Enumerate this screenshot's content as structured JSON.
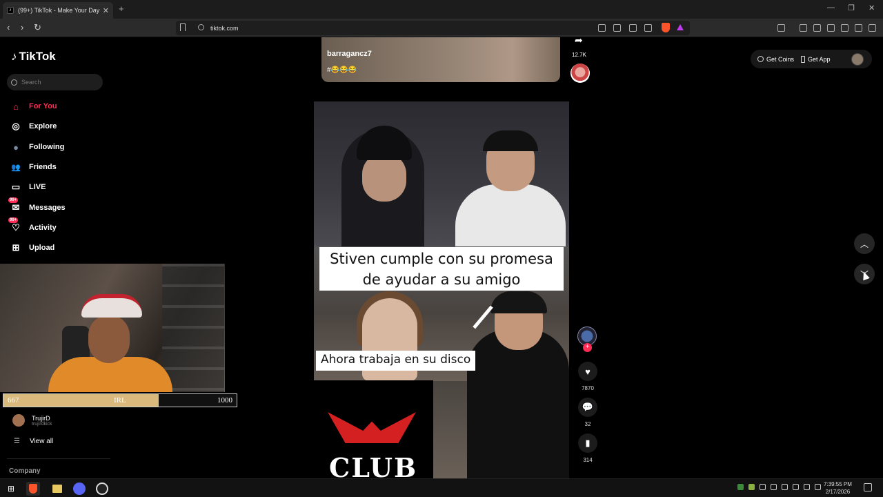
{
  "browser": {
    "tab_title": "(99+) TikTok - Make Your Day",
    "tab_favicon": "tiktok-icon",
    "new_tab": "+",
    "url": "tiktok.com",
    "window_controls": [
      "—",
      "❐",
      "✕"
    ]
  },
  "sidebar": {
    "logo": "TikTok",
    "search_placeholder": "Search",
    "items": [
      {
        "label": "For You",
        "icon": "home-icon",
        "glyph": "⌂",
        "active": true
      },
      {
        "label": "Explore",
        "icon": "compass-icon",
        "glyph": "◎"
      },
      {
        "label": "Following",
        "icon": "following-avatar-icon",
        "glyph": "●"
      },
      {
        "label": "Friends",
        "icon": "friends-icon",
        "glyph": "👥"
      },
      {
        "label": "LIVE",
        "icon": "live-tv-icon",
        "glyph": "▭"
      },
      {
        "label": "Messages",
        "icon": "messages-icon",
        "glyph": "✉",
        "badge": "99+"
      },
      {
        "label": "Activity",
        "icon": "activity-icon",
        "glyph": "♡",
        "badge": "99+"
      },
      {
        "label": "Upload",
        "icon": "upload-icon",
        "glyph": "⊞"
      }
    ],
    "following_account": {
      "name": "TrujirD",
      "handle": "trujirdkick"
    },
    "view_all": "View all",
    "company": "Company"
  },
  "stream_overlay": {
    "goal_current": "667",
    "goal_label": "IRL",
    "goal_max": "1000",
    "goal_fraction": 0.667
  },
  "previous_video": {
    "username": "barragancz7",
    "caption": "#😂😂😂",
    "share_count": "12.7K"
  },
  "video": {
    "caption_line1": "Stiven cumple con su promesa",
    "caption_line2": "de ayudar a su amigo",
    "caption_bottom": "Ahora trabaja en su disco",
    "logo_text": "CLUB",
    "likes": "7870",
    "comments": "32",
    "saves": "314"
  },
  "header": {
    "get_coins": "Get Coins",
    "get_app": "Get App"
  },
  "taskbar": {
    "time": "7:39:55 PM",
    "date": "2/17/2026"
  },
  "colors": {
    "accent": "#fe2c55",
    "goal_fill": "#d9b97c"
  }
}
